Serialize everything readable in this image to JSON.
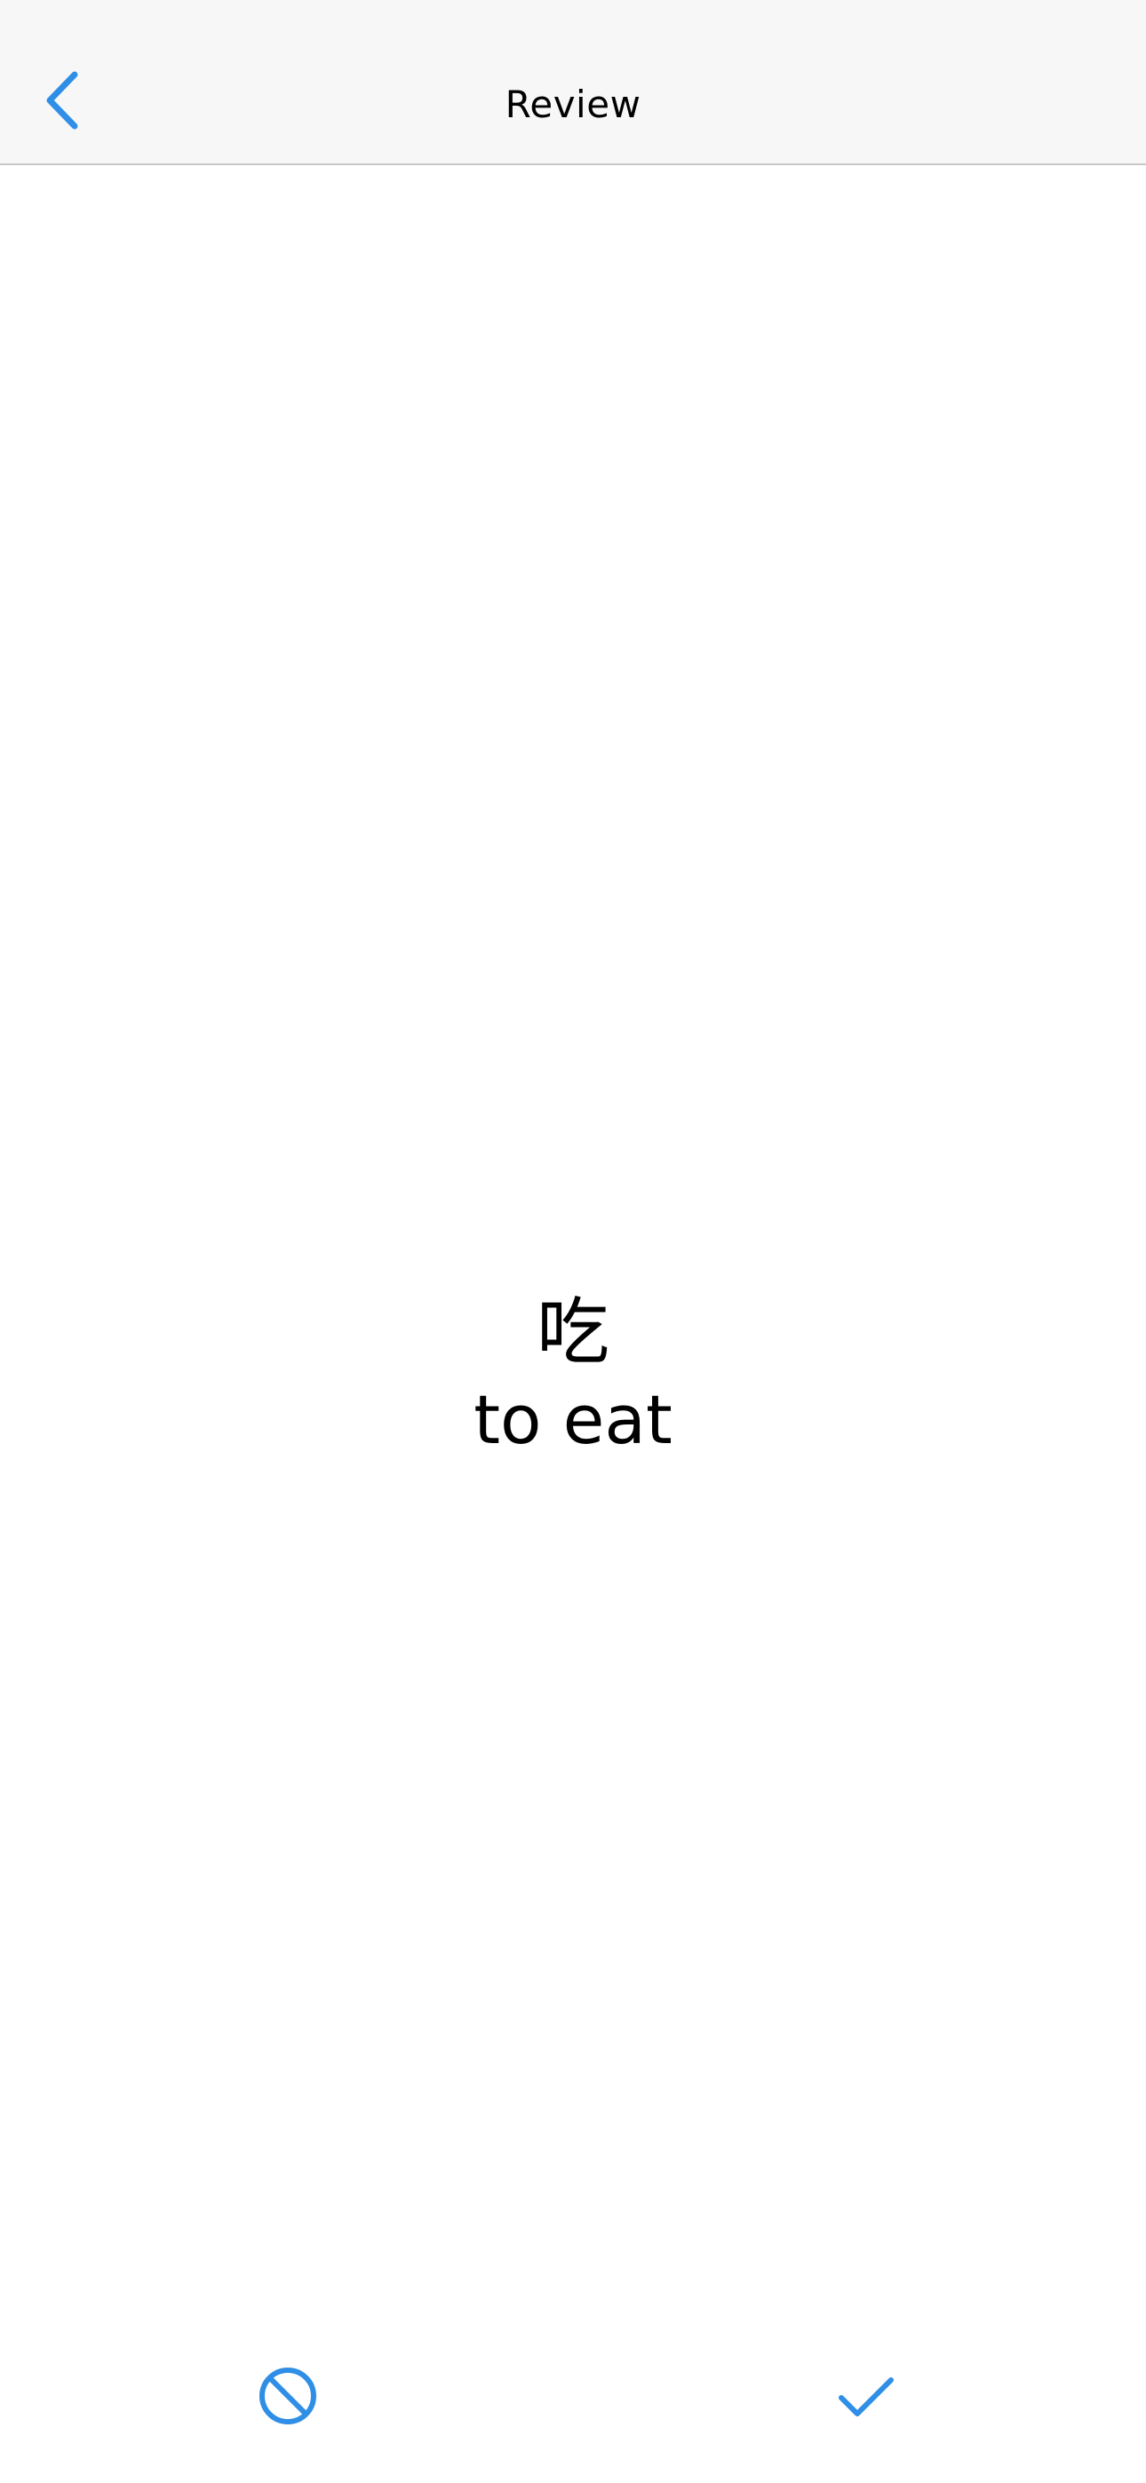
{
  "header": {
    "title": "Review",
    "back_icon": "chevron-left-icon"
  },
  "card": {
    "hanzi": "吃",
    "meaning": "to eat"
  },
  "actions": {
    "reject_icon": "block-icon",
    "accept_icon": "checkmark-icon"
  },
  "colors": {
    "accent": "#2f8ee6",
    "nav_background": "#f7f7f7",
    "divider": "#c8c8cc",
    "text": "#000000",
    "background": "#ffffff"
  }
}
